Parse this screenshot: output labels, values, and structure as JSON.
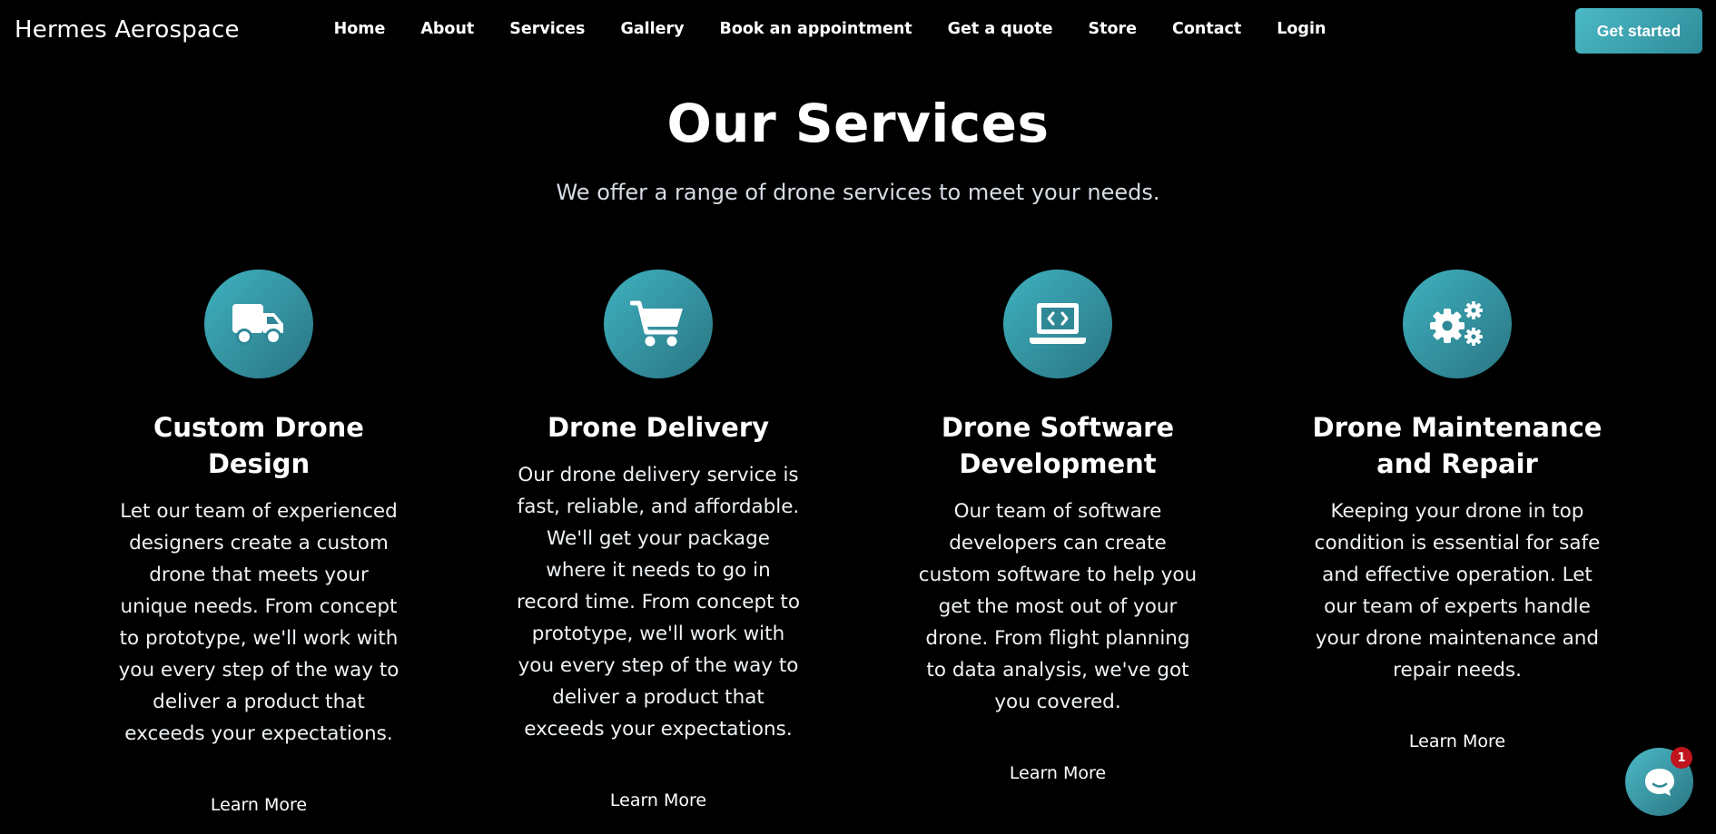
{
  "brand": "Hermes Aerospace",
  "nav": {
    "items": [
      "Home",
      "About",
      "Services",
      "Gallery",
      "Book an appointment",
      "Get a quote",
      "Store",
      "Contact",
      "Login"
    ],
    "cta_label": "Get started"
  },
  "hero": {
    "title": "Our Services",
    "subtitle": "We offer a range of drone services to meet your needs."
  },
  "services": [
    {
      "icon": "truck-icon",
      "title": "Custom Drone Design",
      "description": "Let our team of experienced designers create a custom drone that meets your unique needs. From concept to prototype, we'll work with you every step of the way to deliver a product that exceeds your expectations.",
      "link": "Learn More"
    },
    {
      "icon": "shopping-cart-icon",
      "title": "Drone Delivery",
      "description": "Our drone delivery service is fast, reliable, and affordable. We'll get your package where it needs to go in record time. From concept to prototype, we'll work with you every step of the way to deliver a product that exceeds your expectations.",
      "link": "Learn More"
    },
    {
      "icon": "laptop-code-icon",
      "title": "Drone Software Development",
      "description": "Our team of software developers can create custom software to help you get the most out of your drone. From flight planning to data analysis, we've got you covered.",
      "link": "Learn More"
    },
    {
      "icon": "gears-icon",
      "title": "Drone Maintenance and Repair",
      "description": "Keeping your drone in top condition is essential for safe and effective operation. Let our team of experts handle your drone maintenance and repair needs.",
      "link": "Learn More"
    }
  ],
  "chat": {
    "icon": "chat-icon",
    "badge_count": "1"
  },
  "colors": {
    "background": "#000000",
    "accent": "#3fb1bf",
    "accent_dark": "#2a7583",
    "badge": "#c0141e"
  }
}
